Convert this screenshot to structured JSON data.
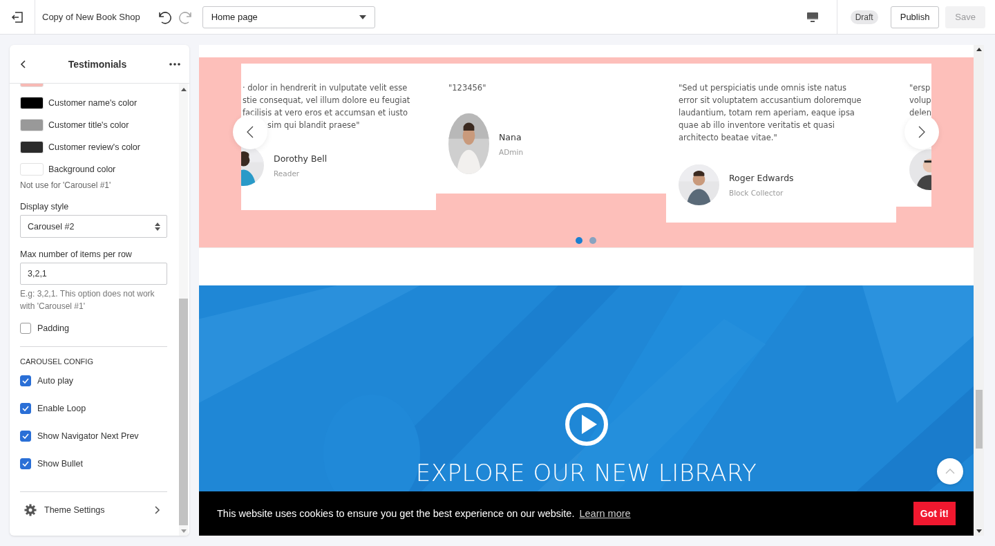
{
  "topbar": {
    "title": "Copy of New Book Shop",
    "page_select": {
      "value": "Home page"
    },
    "status": "Draft",
    "buttons": [
      {
        "label": "Publish",
        "disabled": false
      },
      {
        "label": "Save",
        "disabled": true
      }
    ]
  },
  "panel": {
    "title": "Testimonials",
    "color_settings": [
      {
        "color": "#f7b9b4"
      },
      {
        "label": "Customer name's color",
        "color": "#000000"
      },
      {
        "label": "Customer title's color",
        "color": "#999999"
      },
      {
        "label": "Customer review's color",
        "color": "#2b2b2b"
      },
      {
        "label": "Background color",
        "color": "#ffffff"
      }
    ],
    "background_note": "Not use for 'Carousel #1'",
    "display_style": {
      "label": "Display style",
      "value": "Carousel #2"
    },
    "max_items": {
      "label": "Max number of items per row",
      "value": "3,2,1",
      "hint": "E.g: 3,2,1. This option does not work with 'Carousel #1'"
    },
    "padding": {
      "label": "Padding",
      "checked": false
    },
    "carousel_config": {
      "heading": "CAROUSEL CONFIG",
      "options": [
        {
          "label": "Auto play",
          "checked": true
        },
        {
          "label": "Enable Loop",
          "checked": true
        },
        {
          "label": "Show Navigator Next Prev",
          "checked": true
        },
        {
          "label": "Show Bullet",
          "checked": true
        }
      ]
    },
    "footer": {
      "label": "Theme Settings"
    }
  },
  "preview": {
    "testimonials": [
      {
        "kind": "cut-left",
        "quote_lines": [
          "· dolor in hendrerit in vulputate velit esse",
          "stie consequat, vel illum dolore eu feugiat",
          "facilisis at vero eros et accumsan et iusto",
          "sim qui blandit praese\""
        ],
        "name": "Dorothy Bell",
        "role": "Reader"
      },
      {
        "kind": "full",
        "quote_lines": [
          "\"123456\""
        ],
        "name": "Nana",
        "role": "ADmin"
      },
      {
        "kind": "full",
        "quote_lines": [
          "\"Sed ut perspiciatis unde omnis iste natus",
          "error sit voluptatem accusantium doloremque",
          "laudantium, totam rem aperiam, eaque ipsa",
          "quae ab illo inventore veritatis et quasi",
          "architecto beatae vitae.\""
        ],
        "name": "Roger Edwards",
        "role": "Block Collector"
      },
      {
        "kind": "cut-right",
        "quote_lines": [
          "\"ersp",
          "volup",
          "delen"
        ]
      }
    ],
    "bullets": [
      {
        "selected": true
      },
      {
        "selected": false
      }
    ],
    "video": {
      "heading": "EXPLORE OUR NEW LIBRARY"
    },
    "cookie": {
      "message": "This website uses cookies to ensure you get the best experience on our website.",
      "link": "Learn more",
      "button": "Got it!"
    }
  }
}
